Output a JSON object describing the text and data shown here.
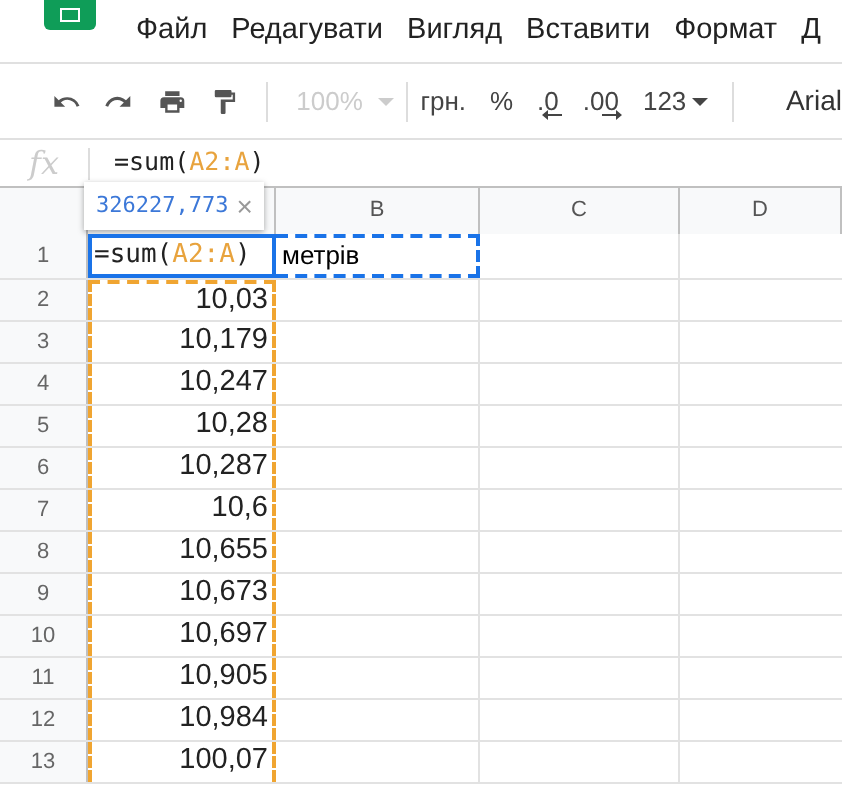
{
  "menu": [
    "Файл",
    "Редагувати",
    "Вигляд",
    "Вставити",
    "Формат",
    "Д"
  ],
  "toolbar": {
    "zoom": {
      "value": "100%",
      "disabled": true
    },
    "items": [
      {
        "text": "грн.",
        "kind": "text"
      },
      {
        "text": "%",
        "kind": "text"
      },
      {
        "text": ".0",
        "kind": "decrease"
      },
      {
        "text": ".00",
        "kind": "increase"
      },
      {
        "text": "123",
        "kind": "dropdown"
      }
    ],
    "font": "Arial"
  },
  "formula_bar": {
    "label": "fx",
    "parts": [
      {
        "text": "=sum(",
        "kind": "plain"
      },
      {
        "text": "A2:A",
        "kind": "range"
      },
      {
        "text": ")",
        "kind": "plain"
      }
    ]
  },
  "tooltip": {
    "value": "326227,773",
    "close": "×"
  },
  "columns": [
    "B",
    "C",
    "D"
  ],
  "editing_cell": {
    "row": "1",
    "parts": [
      {
        "text": "=sum(",
        "kind": "plain"
      },
      {
        "text": "A2:A",
        "kind": "range"
      },
      {
        "text": ")",
        "kind": "plain"
      }
    ],
    "b": "метрів"
  },
  "rows": [
    {
      "n": "2",
      "a": "10,03"
    },
    {
      "n": "3",
      "a": "10,179"
    },
    {
      "n": "4",
      "a": "10,247"
    },
    {
      "n": "5",
      "a": "10,28"
    },
    {
      "n": "6",
      "a": "10,287"
    },
    {
      "n": "7",
      "a": "10,6"
    },
    {
      "n": "8",
      "a": "10,655"
    },
    {
      "n": "9",
      "a": "10,673"
    },
    {
      "n": "10",
      "a": "10,697"
    },
    {
      "n": "11",
      "a": "10,905"
    },
    {
      "n": "12",
      "a": "10,984"
    },
    {
      "n": "13",
      "a": "100,07"
    }
  ]
}
